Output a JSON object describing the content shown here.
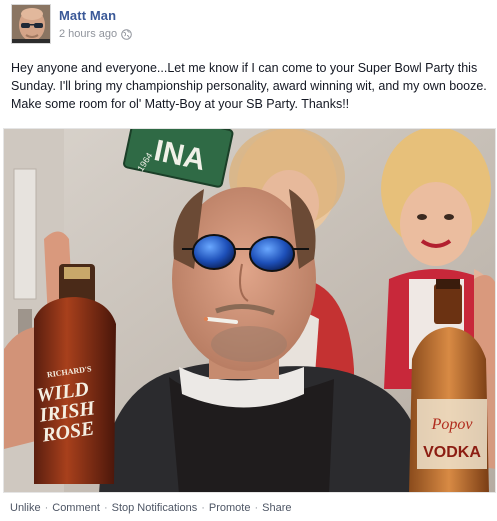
{
  "author": {
    "name": "Matt Man"
  },
  "meta": {
    "time": "2 hours ago",
    "audience_icon": "globe-icon"
  },
  "post": {
    "text": "Hey anyone and everyone...Let me know if I can come to your Super Bowl Party this Sunday. I'll bring my championship personality, award winning wit, and my own booze. Make some room for ol' Matty-Boy at your SB Party. Thanks!!"
  },
  "photo": {
    "bottle_left_label": [
      "RICHARD'S",
      "WILD",
      "IRISH",
      "ROSE"
    ],
    "bottle_right_label": [
      "Popov",
      "VODKA"
    ],
    "plate_text": "INA",
    "plate_year": "1964"
  },
  "actions": {
    "unlike": "Unlike",
    "comment": "Comment",
    "stop_notifications": "Stop Notifications",
    "promote": "Promote",
    "share": "Share",
    "separator": "·"
  },
  "colors": {
    "link": "#3b5998",
    "meta": "#90949c",
    "text": "#141823"
  }
}
